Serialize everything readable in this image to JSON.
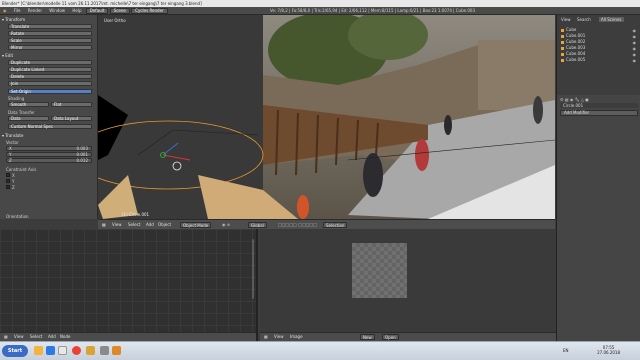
{
  "window": {
    "title": "Blender* [C:\\blender\\modelle 11 vom 26.11.2017\\mt. michelle\\7 ter eingang\\7 ter eingang 3.blend]"
  },
  "menubar": {
    "menus": [
      "File",
      "Render",
      "Window",
      "Help"
    ],
    "layout_select": "Default",
    "scene_select": "Scene",
    "engine_select": "Cycles Render",
    "stats": "Ve: 7/8,2 | Fa:58/8,0 | Tris:2/65,94 | Ed: 2/66,112 | Mem:8/115 | Lamp:0/21 | Box:23 1.0074 | Cube.003"
  },
  "toolshelf": {
    "sections": {
      "transform": "Transform",
      "edit": "Edit",
      "shading": "Shading",
      "data_transfer": "Data Transfer",
      "history": "Custom Normal Spec"
    },
    "transform_buttons": [
      "Translate",
      "Rotate",
      "Scale",
      "Mirror"
    ],
    "edit_buttons": [
      "Duplicate",
      "Duplicate Linked",
      "Delete",
      "Join"
    ],
    "set_origin": "Set Origin",
    "shading_buttons": [
      "Smooth",
      "Flat"
    ],
    "data_buttons": [
      "Data",
      "Data Layout"
    ],
    "operator_panel": "Translate",
    "vector_label": "Vector",
    "vector": [
      {
        "axis": "X",
        "value": "0.003"
      },
      {
        "axis": "Y",
        "value": "0.001"
      },
      {
        "axis": "Z",
        "value": "0.012"
      }
    ],
    "constraint_label": "Constraint Axis",
    "constraints": [
      "X",
      "Y",
      "Z"
    ],
    "orientation_label": "Orientation"
  },
  "viewport": {
    "overlay_title": "User Ortho",
    "object_label": "(1) Circle.001"
  },
  "viewport_header": {
    "menus": [
      "View",
      "Select",
      "Add",
      "Object"
    ],
    "mode": "Object Mode",
    "pivot": "Global",
    "layer_select": "Selection"
  },
  "outliner": {
    "tabs": [
      "View",
      "Search",
      "All Scenes"
    ],
    "items": [
      "Cube",
      "Cube.001",
      "Cube.002",
      "Cube.003",
      "Cube.004",
      "Cube.005"
    ]
  },
  "properties": {
    "object_name": "Circle.001",
    "modifier_button": "Add Modifier"
  },
  "node_editor_header": {
    "menus": [
      "View",
      "Select",
      "Add",
      "Node"
    ]
  },
  "image_editor_header": {
    "menus": [
      "View",
      "Image"
    ],
    "new_button": "New",
    "open_button": "Open"
  },
  "taskbar": {
    "start_label": "Start",
    "time": "07:55",
    "date": "27.06.2018",
    "language": "EN"
  },
  "colors": {
    "accent": "#5680c2",
    "selection": "#e8a23a",
    "background": "#3c3c3c"
  }
}
